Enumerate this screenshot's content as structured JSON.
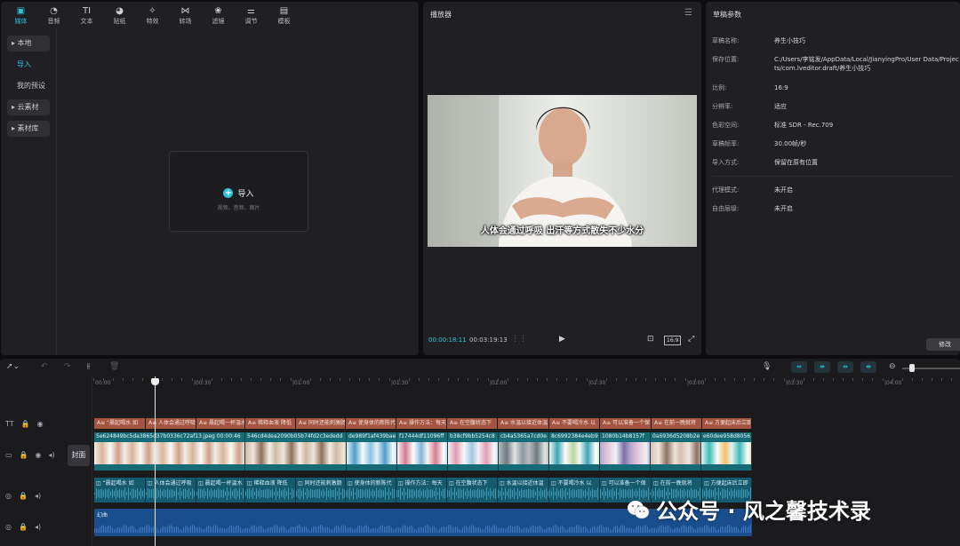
{
  "media_toolbar": {
    "tabs": [
      {
        "label": "媒体",
        "icon": "media-icon"
      },
      {
        "label": "音频",
        "icon": "audio-icon"
      },
      {
        "label": "文本",
        "icon": "text-icon"
      },
      {
        "label": "贴纸",
        "icon": "sticker-icon"
      },
      {
        "label": "特效",
        "icon": "effects-icon"
      },
      {
        "label": "转场",
        "icon": "transition-icon"
      },
      {
        "label": "滤镜",
        "icon": "filter-icon"
      },
      {
        "label": "调节",
        "icon": "adjust-icon"
      },
      {
        "label": "模板",
        "icon": "template-icon"
      }
    ],
    "text_icon_glyph": "TI"
  },
  "media_sidebar": {
    "local": "▸ 本地",
    "import": "导入",
    "my_presets": "我的预设",
    "cloud": "▸ 云素材",
    "library": "▸ 素材库"
  },
  "import_box": {
    "label": "导入",
    "hint": "视频、音频、图片",
    "plus": "+"
  },
  "player": {
    "title": "播放器",
    "subtitle": "人体会通过呼吸 出汗等方式散失不少水分",
    "current_time": "00:00:18:11",
    "total_time": "00:03:19:13",
    "ratio_label": "16:9"
  },
  "properties": {
    "title": "草稿参数",
    "rows": [
      {
        "label": "草稿名称:",
        "value": "养生小技巧"
      },
      {
        "label": "保存位置:",
        "value": "C:/Users/李铭发/AppData/Local/JianyingPro/User Data/Projects/com.lveditor.draft/养生小技巧"
      },
      {
        "label": "比例:",
        "value": "16:9"
      },
      {
        "label": "分辨率:",
        "value": "适应"
      },
      {
        "label": "色彩空间:",
        "value": "标准 SDR - Rec.709"
      },
      {
        "label": "草稿帧率:",
        "value": "30.00帧/秒"
      },
      {
        "label": "导入方式:",
        "value": "保留在原有位置"
      },
      {
        "label": "代理模式:",
        "value": "未开启"
      },
      {
        "label": "自由层级:",
        "value": "未开启"
      }
    ],
    "modify_button": "修改"
  },
  "timeline": {
    "cover_label": "封面",
    "text_track_label": "TT",
    "ruler": [
      "00:00",
      "|00:30",
      "|01:00",
      "|01:30",
      "|02:00",
      "|02:30",
      "|03:00",
      "|03:30",
      "|04:00"
    ],
    "text_clips": [
      "A≡ “晨起喝水 如",
      "A≡ 人体会通过呼吸",
      "A≡ 晨起喝一杯温水",
      "A≡ 稀释血液 降低",
      "A≡ 同时还能刺激肠",
      "A≡ 使身体的新陈代",
      "A≡ 操作方法：每天",
      "A≡ 在空腹状态下",
      "A≡ 水温以接近体温",
      "A≡ 不要喝冷水 以",
      "A≡ 可以准备一个保",
      "A≡ 在前一晚就将",
      "A≡ 方便起床后立即"
    ],
    "video_clips": [
      "5e624849bc5da3865d37b0336c72af13.jpeg  00:00:46",
      "546cd4dea2090b05b74fd2c3ededd",
      "de989f1af439bae",
      "f17444df11096ff",
      "b38cf9bb5254c8",
      "cb4a5365a7cd0e",
      "8c6992384e4eb9",
      "1080b14b8157f",
      "0a6936d5208b2e",
      "e60dee958d8056"
    ],
    "audio_clips": [
      "“晨起喝水 如",
      "人体会通过呼吸",
      "晨起喝一杯温水",
      "稀释血液 降低",
      "同时还能刺激肠",
      "使身体的新陈代",
      "操作方法：每天",
      "在空腹状态下",
      "水温以接近体温",
      "不要喝冷水 以",
      "可以准备一个保",
      "在前一晚就将",
      "方便起床后立即"
    ],
    "bgm_label": "幻曲"
  },
  "watermark": {
    "text": "公众号 · 风之馨技术录"
  },
  "colors": {
    "accent": "#2bc2d6",
    "text_clip": "#a5553f",
    "video_clip": "#176b77",
    "audio_clip": "#155a6e",
    "bgm_clip": "#1a4d8c"
  }
}
